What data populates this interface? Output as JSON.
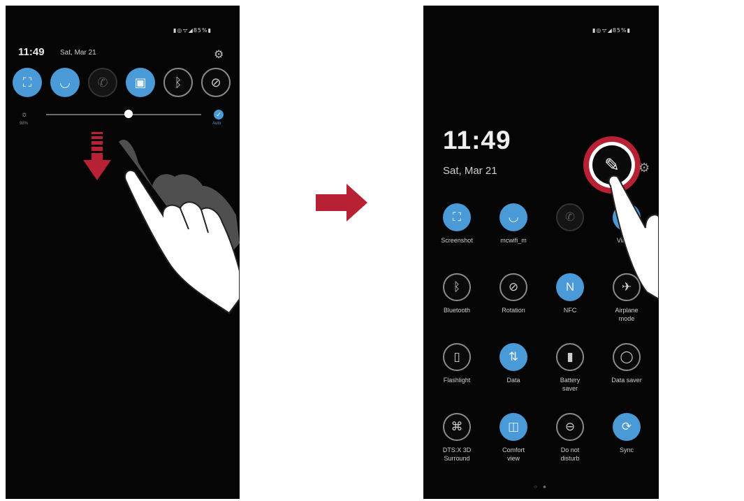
{
  "left_screen": {
    "status_bar_icons": "▮◎ᯤ◢85%▮",
    "time": "11:49",
    "date": "Sat, Mar 21",
    "quick_buttons": [
      {
        "icon": "screenshot-icon",
        "glyph": "⛶",
        "state": "on"
      },
      {
        "icon": "wifi-icon",
        "glyph": "◡",
        "state": "on"
      },
      {
        "icon": "wifi-calling-icon",
        "glyph": "✆",
        "state": "dim"
      },
      {
        "icon": "vibrate-icon",
        "glyph": "▣",
        "state": "on"
      },
      {
        "icon": "bluetooth-icon",
        "glyph": "ᛒ",
        "state": "off"
      },
      {
        "icon": "rotation-icon",
        "glyph": "⊘",
        "state": "off"
      }
    ],
    "brightness_icon": "☼",
    "brightness_value": "98%",
    "brightness_level": 0.53,
    "auto_icon": "✓",
    "auto_label": "Auto"
  },
  "right_screen": {
    "status_bar_icons": "▮◎ᯤ◢85%▮",
    "time": "11:49",
    "date": "Sat, Mar 21",
    "edit_glyph": "✎",
    "gear_glyph": "⚙",
    "page_indicator": "○ ●",
    "tiles": [
      {
        "label": "Screenshot",
        "icon": "screenshot-icon",
        "glyph": "⛶",
        "state": "on"
      },
      {
        "label": "mcwifi_m",
        "icon": "wifi-icon",
        "glyph": "◡",
        "state": "on"
      },
      {
        "label": "",
        "icon": "wifi-calling-icon",
        "glyph": "✆",
        "state": "dim"
      },
      {
        "label": "Vibrate",
        "icon": "vibrate-icon",
        "glyph": "▣",
        "state": "on"
      },
      {
        "label": "Bluetooth",
        "icon": "bluetooth-icon",
        "glyph": "ᛒ",
        "state": "off"
      },
      {
        "label": "Rotation",
        "icon": "rotation-icon",
        "glyph": "⊘",
        "state": "off"
      },
      {
        "label": "NFC",
        "icon": "nfc-icon",
        "glyph": "N",
        "state": "on"
      },
      {
        "label": "Airplane\nmode",
        "icon": "airplane-icon",
        "glyph": "✈",
        "state": "off"
      },
      {
        "label": "Flashlight",
        "icon": "flashlight-icon",
        "glyph": "▯",
        "state": "off"
      },
      {
        "label": "Data",
        "icon": "data-icon",
        "glyph": "⇅",
        "state": "on"
      },
      {
        "label": "Battery\nsaver",
        "icon": "battery-icon",
        "glyph": "▮",
        "state": "off"
      },
      {
        "label": "Data saver",
        "icon": "data-saver-icon",
        "glyph": "◯",
        "state": "off"
      },
      {
        "label": "DTS:X 3D\nSurround",
        "icon": "dts-icon",
        "glyph": "⌘",
        "state": "off"
      },
      {
        "label": "Comfort\nview",
        "icon": "comfort-view-icon",
        "glyph": "◫",
        "state": "on"
      },
      {
        "label": "Do not\ndisturb",
        "icon": "do-not-disturb-icon",
        "glyph": "⊖",
        "state": "off"
      },
      {
        "label": "Sync",
        "icon": "sync-icon",
        "glyph": "⟳",
        "state": "on"
      }
    ]
  },
  "colors": {
    "accent_blue": "#4a9ad8",
    "arrow_red": "#b82034",
    "screen_bg": "#050505"
  }
}
